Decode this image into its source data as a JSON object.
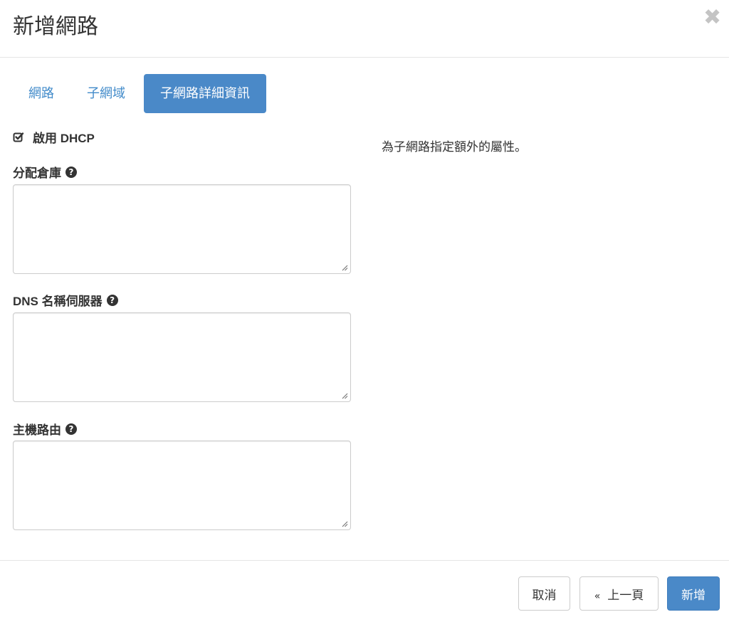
{
  "modal": {
    "title": "新增網路",
    "close_label": "✖"
  },
  "tabs": [
    {
      "label": "網路",
      "active": false
    },
    {
      "label": "子網域",
      "active": false
    },
    {
      "label": "子網路詳細資訊",
      "active": true
    }
  ],
  "form": {
    "dhcp": {
      "label": "啟用 DHCP",
      "checked": true
    },
    "allocation_pools": {
      "label": "分配倉庫",
      "value": ""
    },
    "dns_nameservers": {
      "label": "DNS 名稱伺服器",
      "value": ""
    },
    "host_routes": {
      "label": "主機路由",
      "value": ""
    }
  },
  "description": "為子網路指定額外的屬性。",
  "footer": {
    "cancel_label": "取消",
    "prev_chevron": "«",
    "prev_label": "上一頁",
    "submit_label": "新增"
  },
  "colors": {
    "primary": "#4a89c8",
    "link": "#428bca"
  }
}
